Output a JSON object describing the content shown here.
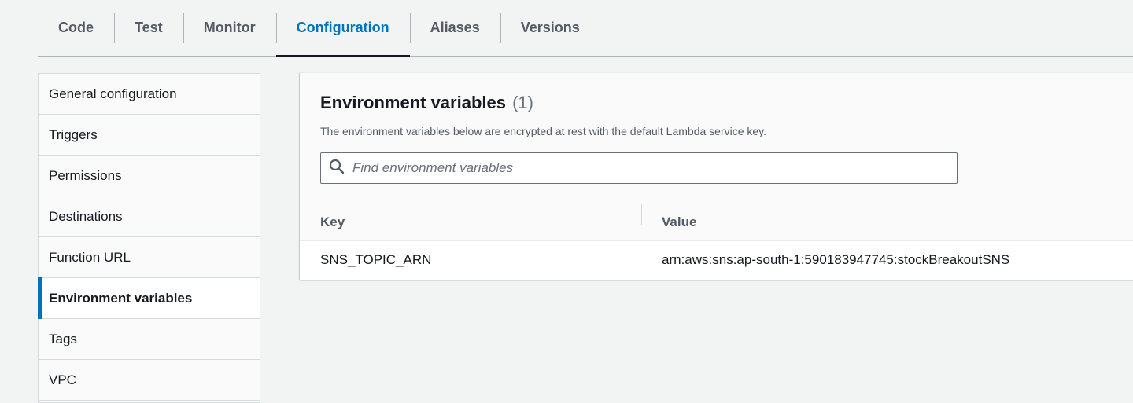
{
  "tabs": [
    {
      "label": "Code",
      "active": false
    },
    {
      "label": "Test",
      "active": false
    },
    {
      "label": "Monitor",
      "active": false
    },
    {
      "label": "Configuration",
      "active": true
    },
    {
      "label": "Aliases",
      "active": false
    },
    {
      "label": "Versions",
      "active": false
    }
  ],
  "sidebar": {
    "items": [
      {
        "label": "General configuration"
      },
      {
        "label": "Triggers"
      },
      {
        "label": "Permissions"
      },
      {
        "label": "Destinations"
      },
      {
        "label": "Function URL"
      },
      {
        "label": "Environment variables",
        "active": true
      },
      {
        "label": "Tags"
      },
      {
        "label": "VPC"
      }
    ]
  },
  "panel": {
    "title": "Environment variables",
    "count": "(1)",
    "description": "The environment variables below are encrypted at rest with the default Lambda service key.",
    "search": {
      "placeholder": "Find environment variables",
      "icon": "search-icon"
    },
    "table": {
      "headers": {
        "key": "Key",
        "value": "Value"
      },
      "rows": [
        {
          "key": "SNS_TOPIC_ARN",
          "value": "arn:aws:sns:ap-south-1:590183947745:stockBreakoutSNS"
        }
      ]
    }
  },
  "colors": {
    "accent": "#0073bb",
    "background": "#f2f3f3"
  }
}
